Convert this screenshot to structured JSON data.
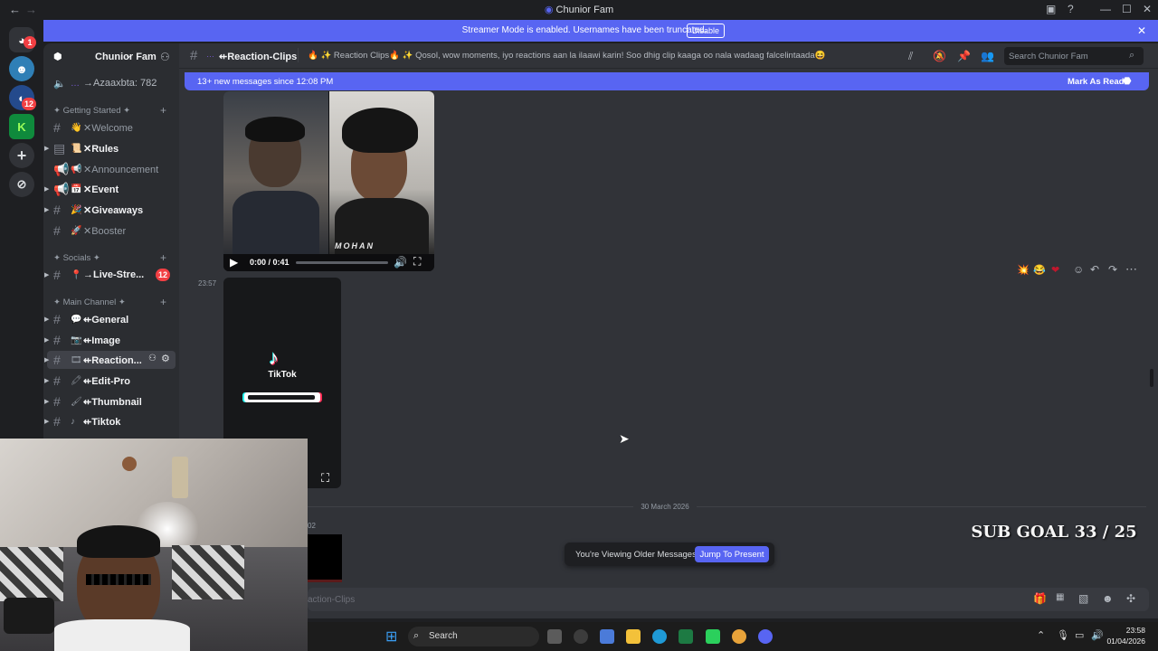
{
  "window": {
    "title": "Chunior Fam"
  },
  "streamer_banner": {
    "message": "Streamer Mode is enabled. Usernames have been truncated.",
    "disable_label": "Disable"
  },
  "server": {
    "name": "Chunior Fam",
    "voice_channel": {
      "name": "→Azaaxbta: 782"
    },
    "categories": [
      {
        "label": "✦ Getting Started ✦"
      },
      {
        "label": "✦ Socials ✦"
      },
      {
        "label": "✦ Main Channel ✦"
      }
    ],
    "channels": [
      {
        "name": "✕Welcome",
        "emoji": "👋"
      },
      {
        "name": "✕Rules",
        "emoji": "📜"
      },
      {
        "name": "✕Announcement",
        "emoji": "📢"
      },
      {
        "name": "✕Event",
        "emoji": "📅"
      },
      {
        "name": "✕Giveaways",
        "emoji": "🎉"
      },
      {
        "name": "✕Booster",
        "emoji": "🚀"
      },
      {
        "name": "→Live-Stre...",
        "emoji": "📍",
        "badge": "12"
      },
      {
        "name": "⇷General",
        "emoji": "💬"
      },
      {
        "name": "⇷Image",
        "emoji": "📷"
      },
      {
        "name": "⇷Reaction...",
        "emoji": "🎞"
      },
      {
        "name": "⇷Edit-Pro",
        "emoji": "🖍"
      },
      {
        "name": "⇷Thumbnail",
        "emoji": "🖌"
      },
      {
        "name": "⇷Tiktok",
        "emoji": "♪"
      }
    ]
  },
  "rail": {
    "badges": [
      "1",
      "12"
    ]
  },
  "channel_header": {
    "name": "⇷Reaction-Clips",
    "topic": "🔥 ✨ Reaction Clips🔥 ✨ Qosol, wow moments, iyo reactions aan la ilaawi karin! Soo dhig clip kaaga oo nala wadaag falcelintaada😆",
    "search_placeholder": "Search Chunior Fam"
  },
  "new_messages": {
    "text": "13+ new messages since 12:08 PM",
    "mark_read": "Mark As Read"
  },
  "messages": {
    "clip_watermark": "MOHAN",
    "video_time": "0:00 / 0:41",
    "timestamp_2357": "23:57",
    "tiktok_label": "TikTok",
    "date_divider": "30 March 2026",
    "partial_time": "02"
  },
  "older_bar": {
    "text": "You're Viewing Older Messages",
    "jump_label": "Jump To Present"
  },
  "composer": {
    "partial_placeholder": "action-Clips"
  },
  "overlay": {
    "sub_goal": "SUB GOAL 33 / 25"
  },
  "taskbar": {
    "search_label": "Search",
    "time": "23:58",
    "date": "01/04/2026"
  },
  "colors": {
    "accent": "#5865f2",
    "badge": "#f23f43",
    "bg_main": "#313338",
    "bg_sidebar": "#2b2d31"
  }
}
